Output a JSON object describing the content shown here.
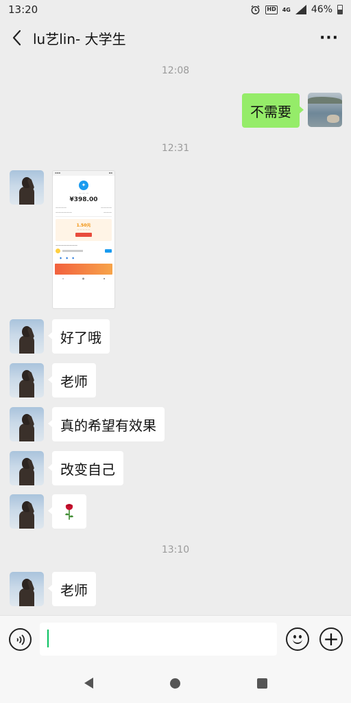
{
  "status_bar": {
    "time": "13:20",
    "alarm_icon": "alarm-icon",
    "hd_label": "HD",
    "network_label": "4G",
    "battery_percent": "46%"
  },
  "header": {
    "back_icon": "chevron-left-icon",
    "title": "lu艺lin- 大学生",
    "more_icon": "more-dots-icon",
    "more_label": "···"
  },
  "messages": {
    "ts1": "12:08",
    "m1": "不需要",
    "ts2": "12:31",
    "image": {
      "amount": "¥398.00",
      "card_value": "1.50元"
    },
    "m2": "好了哦",
    "m3": "老师",
    "m4": "真的希望有效果",
    "m5": "改变自己",
    "m6": "🌹",
    "ts3": "13:10",
    "m7": "老师"
  },
  "input": {
    "value": "",
    "voice_icon": "voice-icon",
    "emoji_icon": "emoji-icon",
    "plus_icon": "plus-icon",
    "plus_label": "+"
  },
  "nav": {
    "back_icon": "nav-back-icon",
    "home_icon": "nav-home-icon",
    "recent_icon": "nav-recent-icon"
  },
  "colors": {
    "background": "#ededed",
    "self_bubble": "#95ec69",
    "other_bubble": "#ffffff",
    "timestamp": "#9a9a9a",
    "cursor": "#07c160"
  }
}
